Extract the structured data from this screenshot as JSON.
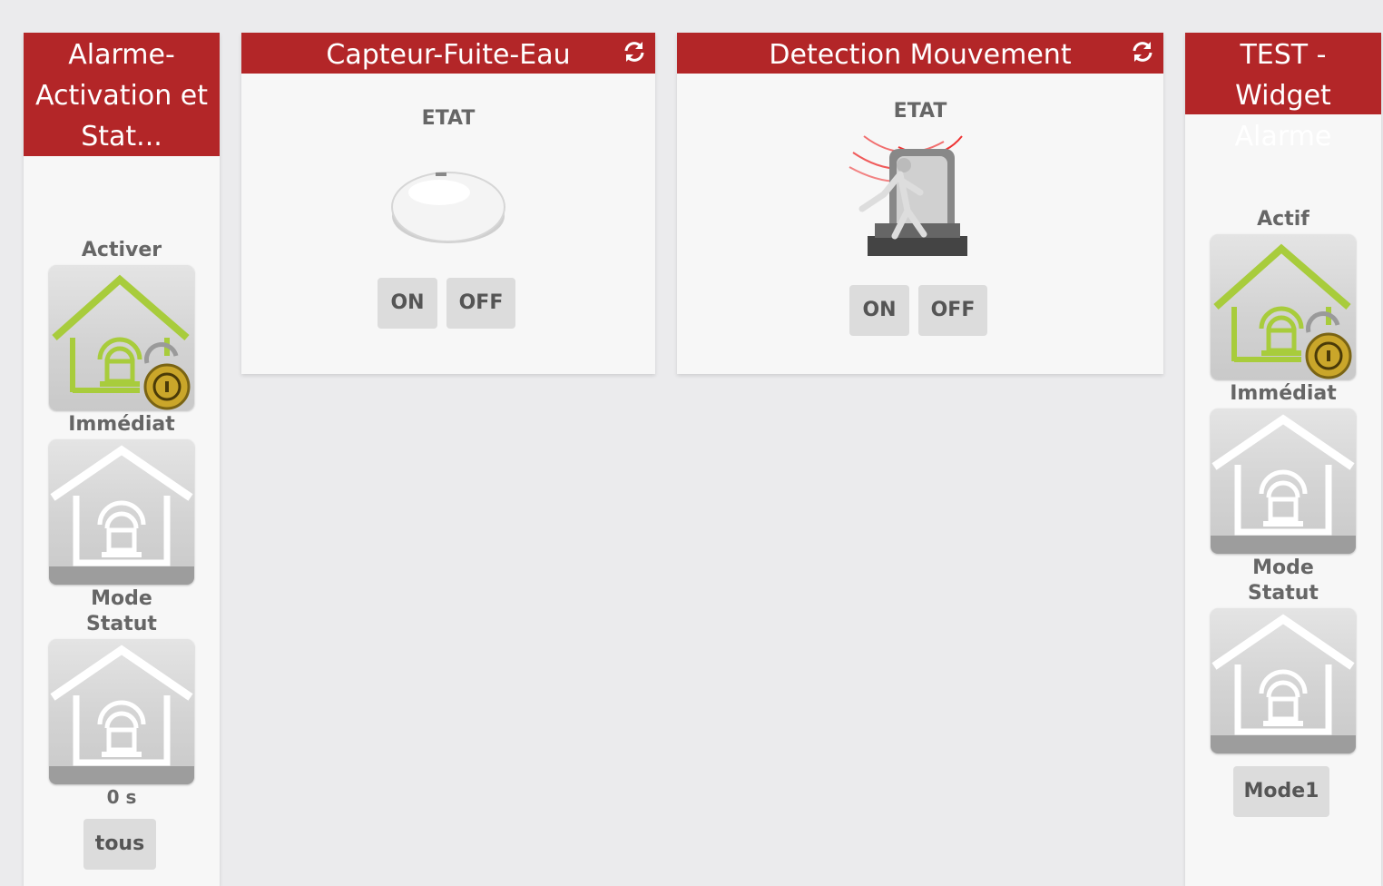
{
  "colors": {
    "header": "#b32628",
    "green": "#a8cc3c",
    "background": "#ebebed"
  },
  "widget_alarme": {
    "title": "Alarme-Activation et Stat...",
    "label_activer": "Activer",
    "label_immediat": "Immédiat",
    "label_mode_statut": "Mode Statut",
    "delay": "0 s",
    "button_tous": "tous"
  },
  "widget_fuite": {
    "title": "Capteur-Fuite-Eau",
    "label_etat": "ETAT",
    "button_on": "ON",
    "button_off": "OFF",
    "icons": {
      "refresh": "refresh-icon",
      "sensor": "water-leak-sensor-icon"
    }
  },
  "widget_mouvement": {
    "title": "Detection Mouvement",
    "label_etat": "ETAT",
    "button_on": "ON",
    "button_off": "OFF",
    "icons": {
      "refresh": "refresh-icon",
      "sensor": "motion-alarm-siren-icon"
    }
  },
  "widget_test": {
    "title": "TEST - Widget Alarme",
    "label_actif": "Actif",
    "label_immediat": "Immédiat",
    "label_mode_statut": "Mode Statut",
    "button_mode": "Mode1"
  }
}
